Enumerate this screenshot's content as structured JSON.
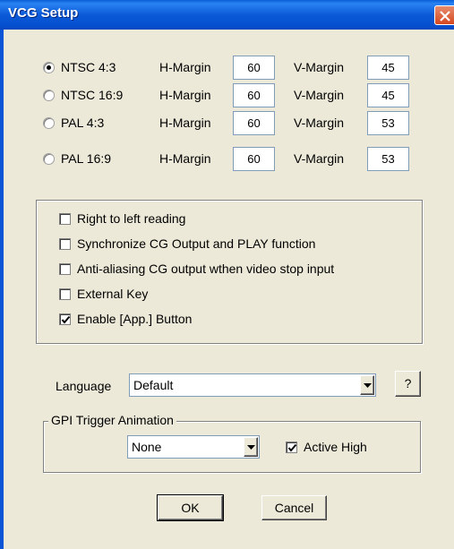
{
  "window": {
    "title": "VCG Setup"
  },
  "video_modes": [
    {
      "label": "NTSC 4:3",
      "selected": true,
      "h_margin": "60",
      "v_margin": "45"
    },
    {
      "label": "NTSC 16:9",
      "selected": false,
      "h_margin": "60",
      "v_margin": "45"
    },
    {
      "label": "PAL 4:3",
      "selected": false,
      "h_margin": "60",
      "v_margin": "53"
    },
    {
      "label": "PAL 16:9",
      "selected": false,
      "h_margin": "60",
      "v_margin": "53"
    }
  ],
  "labels": {
    "h_margin": "H-Margin",
    "v_margin": "V-Margin"
  },
  "options": [
    {
      "label": "Right to left reading",
      "checked": false
    },
    {
      "label": "Synchronize CG Output and PLAY function",
      "checked": false
    },
    {
      "label": "Anti-aliasing CG output wthen video stop input",
      "checked": false
    },
    {
      "label": "External Key",
      "checked": false
    },
    {
      "label": "Enable [App.] Button",
      "checked": true
    }
  ],
  "language": {
    "label": "Language",
    "value": "Default",
    "help_label": "?"
  },
  "gpi": {
    "group_title": "GPI Trigger Animation",
    "value": "None",
    "active_high_label": "Active High",
    "active_high_checked": true
  },
  "buttons": {
    "ok": "OK",
    "cancel": "Cancel"
  }
}
